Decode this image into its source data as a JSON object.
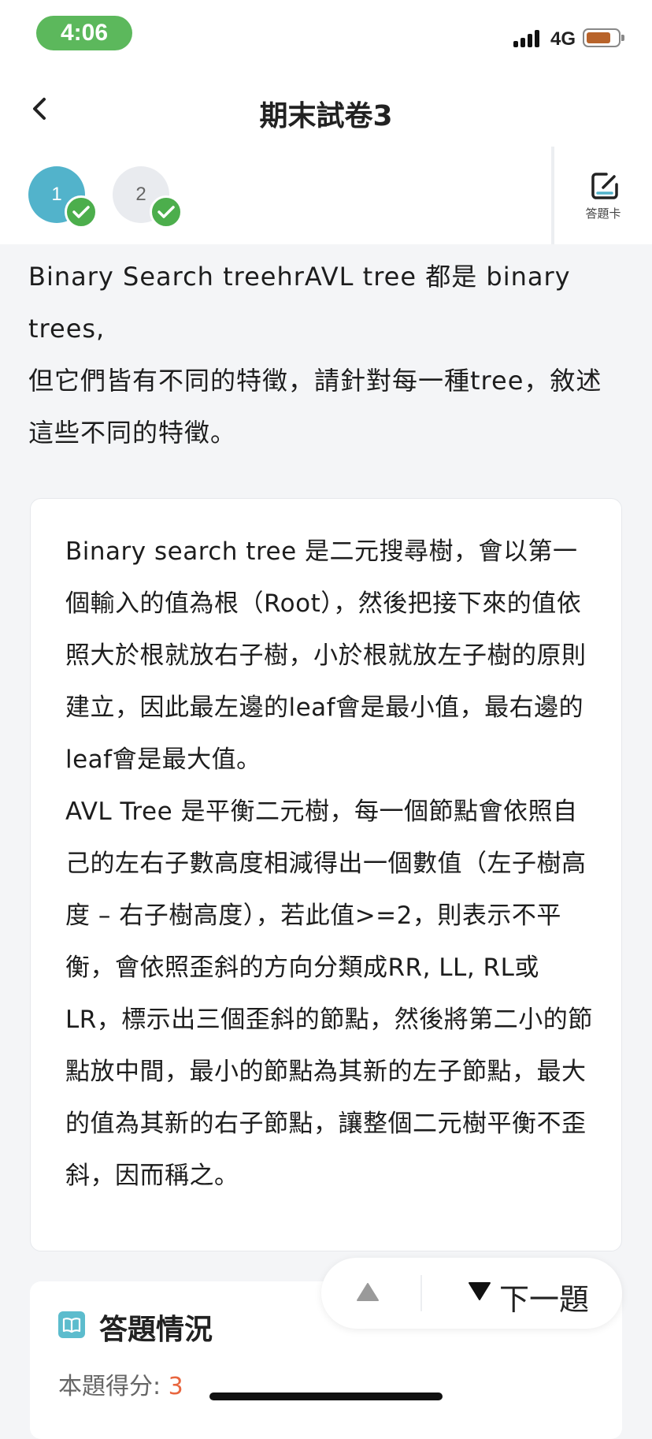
{
  "status_bar": {
    "time": "4:06",
    "network": "4G"
  },
  "nav": {
    "title": "期末試卷3"
  },
  "question_nav": {
    "items": [
      {
        "number": "1",
        "answered": true,
        "current": true
      },
      {
        "number": "2",
        "answered": true,
        "current": false
      }
    ],
    "answer_card_label": "答題卡"
  },
  "question": {
    "line1": "Binary Search treehrAVL tree 都是 binary trees,",
    "line2": "但它們皆有不同的特徵，請針對每一種tree，敘述這些不同的特徵。"
  },
  "answer": {
    "paragraph1": "Binary search tree 是二元搜尋樹，會以第一個輸入的值為根（Root），然後把接下來的值依照大於根就放右子樹，小於根就放左子樹的原則建立，因此最左邊的leaf會是最小值，最右邊的leaf會是最大值。",
    "paragraph2": "AVL Tree 是平衡二元樹，每一個節點會依照自己的左右子數高度相減得出一個數值（左子樹高度 – 右子樹高度），若此值>=2，則表示不平衡，會依照歪斜的方向分類成RR, LL, RL或LR，標示出三個歪斜的節點，然後將第二小的節點放中間，最小的節點為其新的左子節點，最大的值為其新的右子節點，讓整個二元樹平衡不歪斜，因而稱之。"
  },
  "result": {
    "title": "答題情況",
    "score_label": "本題得分: ",
    "score_value": "3"
  },
  "float_nav": {
    "next_label": "下一題"
  },
  "colors": {
    "accent": "#52b3cb",
    "check": "#4cae4c",
    "time_pill": "#5cb85c",
    "score": "#e8663f"
  }
}
